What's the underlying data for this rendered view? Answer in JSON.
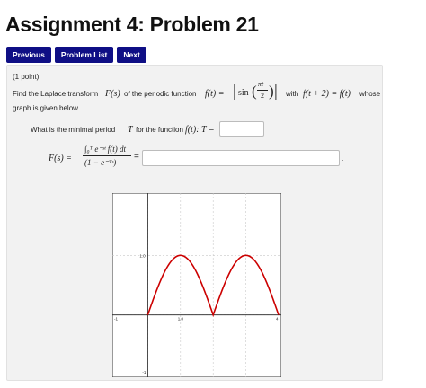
{
  "page": {
    "title": "Assignment 4: Problem 21"
  },
  "nav": {
    "previous_label": "Previous",
    "problem_list_label": "Problem List",
    "next_label": "Next",
    "button_color": "#0f0f85"
  },
  "problem": {
    "points": "(1 point)",
    "statement_prefix": "Find the Laplace transform",
    "statement_mid": "of the periodic function",
    "statement_with": "with",
    "statement_whose": "whose",
    "statement_line2": "graph is given below.",
    "Fs": "F(s)",
    "ft": "f(t) =",
    "sin_fn": "sin",
    "pi_t": "πt",
    "two": "2",
    "periodic_cond": "f(t + 2) = f(t)",
    "period_question": "What is the minimal period",
    "period_var": "T",
    "period_question_tail": "for the function",
    "period_eq": "f(t): T =",
    "period_answer": "",
    "Fs_eq": "F(s) =",
    "integral_num": "∫₀ᵀ e⁻ˢᵗ f(t) dt",
    "integral_den": "(1 − e⁻ᵀˢ)",
    "equals": "=",
    "Fs_answer": "",
    "period_dot": "."
  },
  "graph": {
    "y_tick_top": "1.0",
    "y_tick_bottom": "-1",
    "x_tick_left": "-1",
    "x_tick_mid": "1.0",
    "x_tick_right": "4",
    "curve_color": "#cc0000"
  },
  "chart_data": {
    "type": "line",
    "series": [
      {
        "function": "|sin(pi*t/2)|"
      }
    ],
    "xlim": [
      -1,
      4
    ],
    "ylim": [
      -1,
      2
    ],
    "grid": true
  }
}
